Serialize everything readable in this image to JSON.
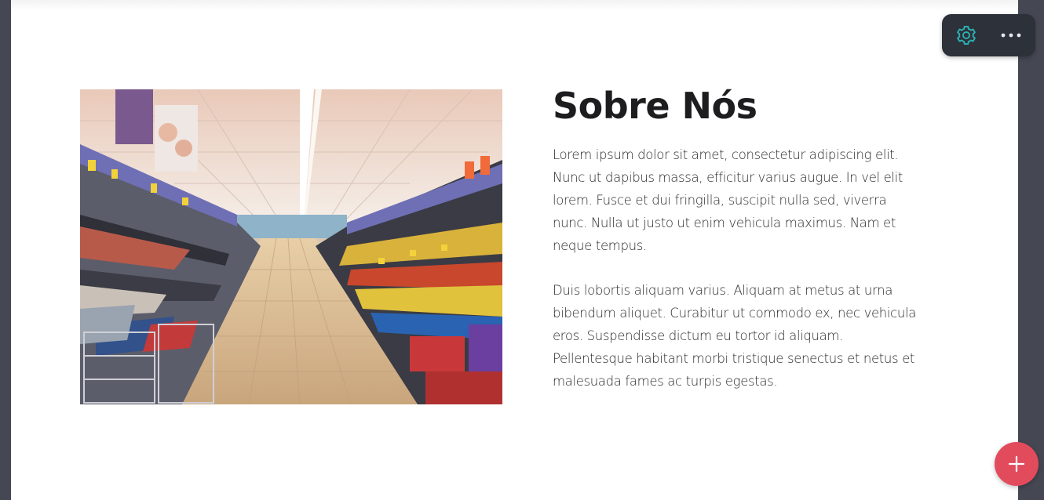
{
  "about": {
    "title": "Sobre Nós",
    "paragraph_1": "Lorem ipsum dolor sit amet, consectetur adipiscing elit. Nunc ut dapibus massa, efficitur varius augue. In vel elit lorem. Fusce et dui fringilla, suscipit nulla sed, viverra nunc. Nulla ut justo ut enim vehicula maximus. Nam et neque tempus.",
    "paragraph_2": "Duis lobortis aliquam varius. Aliquam at metus at urna bibendum aliquet. Curabitur ut commodo ex, nec vehicula eros. Suspendisse dictum eu tortor id aliquam. Pellentesque habitant morbi tristique senectus et netus et malesuada fames ac turpis egestas.",
    "image_icon": "supermarket-aisle-photo"
  },
  "toolbar": {
    "settings_icon": "gear-icon",
    "more_icon": "more-horizontal-icon"
  },
  "fab": {
    "icon": "plus-icon"
  },
  "colors": {
    "page_bg": "#454753",
    "canvas_bg": "#ffffff",
    "title": "#1d1d1f",
    "text": "#2a2a2a",
    "toolbar_bg": "#2d313a",
    "gear_accent": "#2bb3b5",
    "fab_bg": "#e24b5b"
  }
}
